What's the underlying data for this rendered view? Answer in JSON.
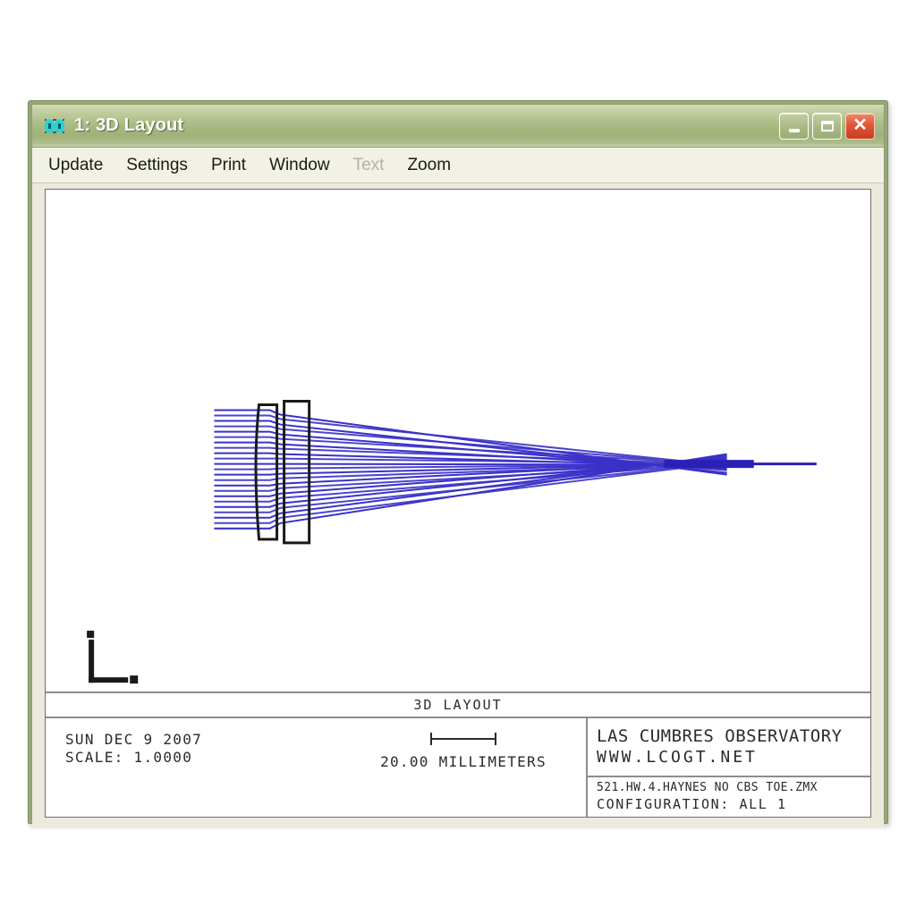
{
  "window": {
    "title": "1: 3D Layout",
    "icon": "zemax-window-icon",
    "icon_color": "#22d3d8",
    "titlebar_color": "#a9bb84",
    "frame_color": "#97a878",
    "buttons": {
      "minimize": "minimize",
      "maximize": "maximize",
      "close": "close"
    }
  },
  "menubar": {
    "items": [
      {
        "label": "Update",
        "disabled": false
      },
      {
        "label": "Settings",
        "disabled": false
      },
      {
        "label": "Print",
        "disabled": false
      },
      {
        "label": "Window",
        "disabled": false
      },
      {
        "label": "Text",
        "disabled": true
      },
      {
        "label": "Zoom",
        "disabled": false
      }
    ]
  },
  "footer": {
    "title": "3D LAYOUT",
    "date": "SUN DEC 9 2007",
    "scale": "SCALE:  1.0000",
    "scalebar_label": "20.00 MILLIMETERS",
    "organization": "LAS CUMBRES OBSERVATORY",
    "website": "WWW.LCOGT.NET",
    "filename": "521.HW.4.HAYNES NO CBS TOE.ZMX",
    "configuration": "CONFIGURATION:  ALL 1"
  },
  "plot": {
    "axis_indicator": "yz-axis-indicator",
    "ray_color": "#3a31c8",
    "lens_color": "#1a1a1a",
    "ray_count": 10,
    "description": "3D layout ray trace of a two-element lens system with collimated input rays converging to a focus"
  }
}
